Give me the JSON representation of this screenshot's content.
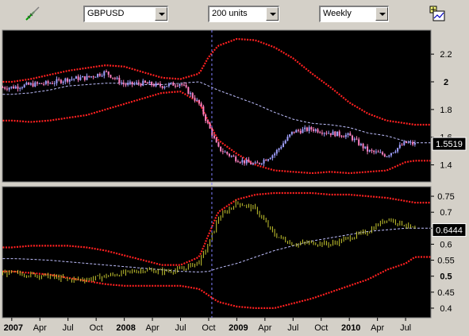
{
  "toolbar": {
    "symbol": "GBPUSD",
    "units": "200 units",
    "period": "Weekly",
    "icons": [
      "draw-tool-icon",
      "chart-settings-icon"
    ]
  },
  "colors": {
    "background": "#000000",
    "frame": "#d4d0c8",
    "candle_up": "#a0a0ff",
    "candle_down": "#ff80c0",
    "band": "#ff2020",
    "mid_line": "#c0c0ff",
    "oscillator": "#c8c830",
    "cursor_line": "#8080ff"
  },
  "chart_data": [
    {
      "type": "line",
      "panel": "price",
      "y_ticks": [
        "2.2",
        "2",
        "1.8",
        "1.6",
        "1.4"
      ],
      "bold_ticks": [
        "2"
      ],
      "ylim": [
        1.3,
        2.35
      ],
      "current_value": "1.5519",
      "x": [
        "2007-01",
        "2007-03",
        "2007-05",
        "2007-07",
        "2007-09",
        "2007-11",
        "2008-01",
        "2008-03",
        "2008-05",
        "2008-07",
        "2008-09",
        "2008-10",
        "2008-11",
        "2009-01",
        "2009-03",
        "2009-05",
        "2009-07",
        "2009-09",
        "2009-11",
        "2010-01",
        "2010-03",
        "2010-05",
        "2010-07",
        "2010-08"
      ],
      "series": [
        {
          "role": "price",
          "values": [
            1.96,
            1.98,
            1.99,
            2.02,
            2.03,
            2.07,
            1.98,
            1.99,
            1.97,
            1.99,
            1.84,
            1.68,
            1.52,
            1.44,
            1.4,
            1.48,
            1.64,
            1.66,
            1.63,
            1.61,
            1.5,
            1.47,
            1.56,
            1.55
          ]
        },
        {
          "role": "upper",
          "values": [
            2.0,
            2.02,
            2.05,
            2.08,
            2.1,
            2.12,
            2.11,
            2.07,
            2.03,
            2.02,
            2.06,
            2.18,
            2.26,
            2.31,
            2.3,
            2.25,
            2.17,
            2.06,
            1.96,
            1.85,
            1.77,
            1.72,
            1.7,
            1.69
          ]
        },
        {
          "role": "middle",
          "values": [
            1.91,
            1.92,
            1.94,
            1.97,
            1.98,
            1.99,
            1.99,
            1.98,
            1.98,
            1.99,
            2.0,
            1.97,
            1.94,
            1.89,
            1.84,
            1.78,
            1.73,
            1.7,
            1.69,
            1.67,
            1.63,
            1.61,
            1.57,
            1.56
          ]
        },
        {
          "role": "lower",
          "values": [
            1.72,
            1.71,
            1.72,
            1.74,
            1.76,
            1.8,
            1.84,
            1.88,
            1.92,
            1.93,
            1.85,
            1.71,
            1.58,
            1.48,
            1.4,
            1.36,
            1.35,
            1.34,
            1.35,
            1.34,
            1.35,
            1.36,
            1.42,
            1.43
          ]
        }
      ]
    },
    {
      "type": "line",
      "panel": "oscillator",
      "y_ticks": [
        "0.75",
        "0.7",
        "0.65",
        "0.6",
        "0.55",
        "0.5",
        "0.45",
        "0.4"
      ],
      "bold_ticks": [
        "0.5"
      ],
      "ylim": [
        0.38,
        0.77
      ],
      "current_value": "0.6444",
      "x": [
        "2007-01",
        "2007-03",
        "2007-05",
        "2007-07",
        "2007-09",
        "2007-11",
        "2008-01",
        "2008-03",
        "2008-05",
        "2008-07",
        "2008-09",
        "2008-10",
        "2008-11",
        "2009-01",
        "2009-03",
        "2009-05",
        "2009-07",
        "2009-09",
        "2009-11",
        "2010-01",
        "2010-03",
        "2010-05",
        "2010-07",
        "2010-08"
      ],
      "series": [
        {
          "role": "oscillator",
          "values": [
            0.51,
            0.505,
            0.5,
            0.49,
            0.49,
            0.5,
            0.51,
            0.52,
            0.515,
            0.52,
            0.545,
            0.6,
            0.68,
            0.73,
            0.71,
            0.63,
            0.6,
            0.605,
            0.6,
            0.62,
            0.64,
            0.68,
            0.66,
            0.645
          ]
        },
        {
          "role": "upper",
          "values": [
            0.59,
            0.595,
            0.595,
            0.595,
            0.59,
            0.58,
            0.565,
            0.55,
            0.535,
            0.535,
            0.56,
            0.63,
            0.7,
            0.74,
            0.755,
            0.76,
            0.76,
            0.76,
            0.755,
            0.755,
            0.75,
            0.745,
            0.735,
            0.73
          ]
        },
        {
          "role": "middle",
          "values": [
            0.555,
            0.553,
            0.55,
            0.545,
            0.54,
            0.535,
            0.53,
            0.525,
            0.52,
            0.515,
            0.513,
            0.515,
            0.525,
            0.54,
            0.56,
            0.58,
            0.595,
            0.61,
            0.62,
            0.63,
            0.64,
            0.645,
            0.65,
            0.65
          ]
        },
        {
          "role": "lower",
          "values": [
            0.515,
            0.51,
            0.505,
            0.495,
            0.485,
            0.475,
            0.47,
            0.47,
            0.47,
            0.47,
            0.46,
            0.44,
            0.42,
            0.405,
            0.4,
            0.4,
            0.415,
            0.43,
            0.45,
            0.47,
            0.49,
            0.52,
            0.54,
            0.56
          ]
        }
      ]
    }
  ],
  "x_axis": {
    "labels": [
      {
        "text": "2007",
        "bold": true,
        "date": "2007-01"
      },
      {
        "text": "Apr",
        "bold": false,
        "date": "2007-04"
      },
      {
        "text": "Jul",
        "bold": false,
        "date": "2007-07"
      },
      {
        "text": "Oct",
        "bold": false,
        "date": "2007-10"
      },
      {
        "text": "2008",
        "bold": true,
        "date": "2008-01"
      },
      {
        "text": "Apr",
        "bold": false,
        "date": "2008-04"
      },
      {
        "text": "Jul",
        "bold": false,
        "date": "2008-07"
      },
      {
        "text": "Oct",
        "bold": false,
        "date": "2008-10"
      },
      {
        "text": "2009",
        "bold": true,
        "date": "2009-01"
      },
      {
        "text": "Apr",
        "bold": false,
        "date": "2009-04"
      },
      {
        "text": "Jul",
        "bold": false,
        "date": "2009-07"
      },
      {
        "text": "Oct",
        "bold": false,
        "date": "2009-10"
      },
      {
        "text": "2010",
        "bold": true,
        "date": "2010-01"
      },
      {
        "text": "Apr",
        "bold": false,
        "date": "2010-04"
      },
      {
        "text": "Jul",
        "bold": false,
        "date": "2010-07"
      }
    ],
    "cursor_date": "2008-10"
  }
}
